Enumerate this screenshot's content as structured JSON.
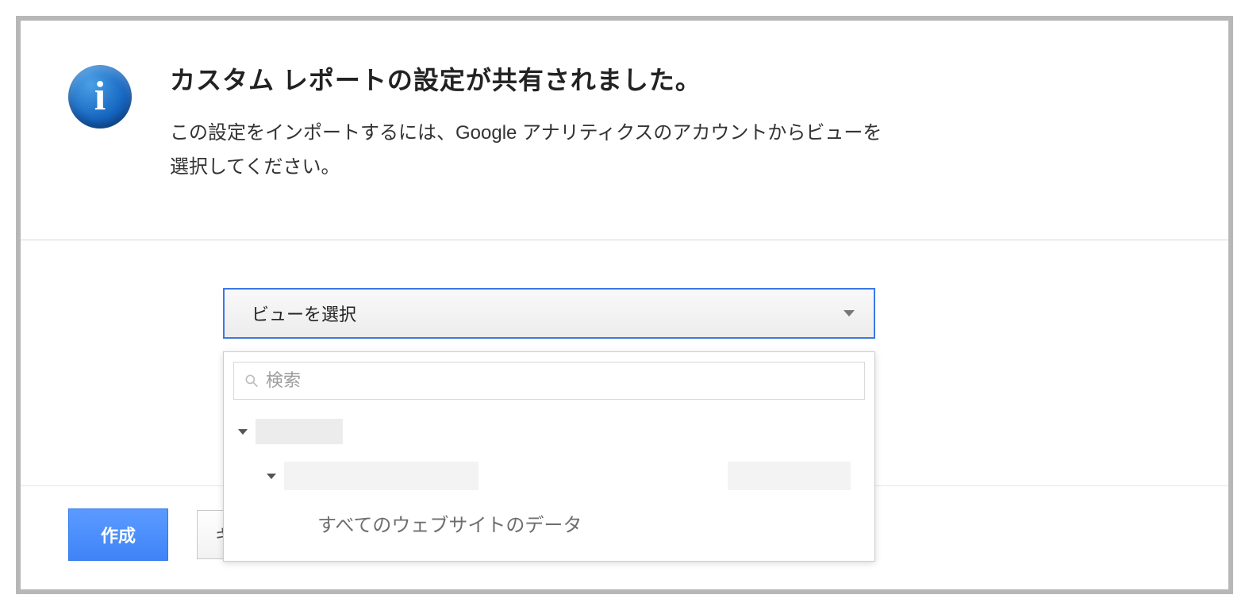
{
  "header": {
    "title": "カスタム レポートの設定が共有されました。",
    "description": "この設定をインポートするには、Google アナリティクスのアカウントからビューを選択してください。"
  },
  "selector": {
    "button_label": "ビューを選択",
    "search_placeholder": "検索",
    "tree": {
      "leaf_label": "すべてのウェブサイトのデータ"
    }
  },
  "footer": {
    "create_label": "作成",
    "cancel_label": "キャンセル"
  }
}
